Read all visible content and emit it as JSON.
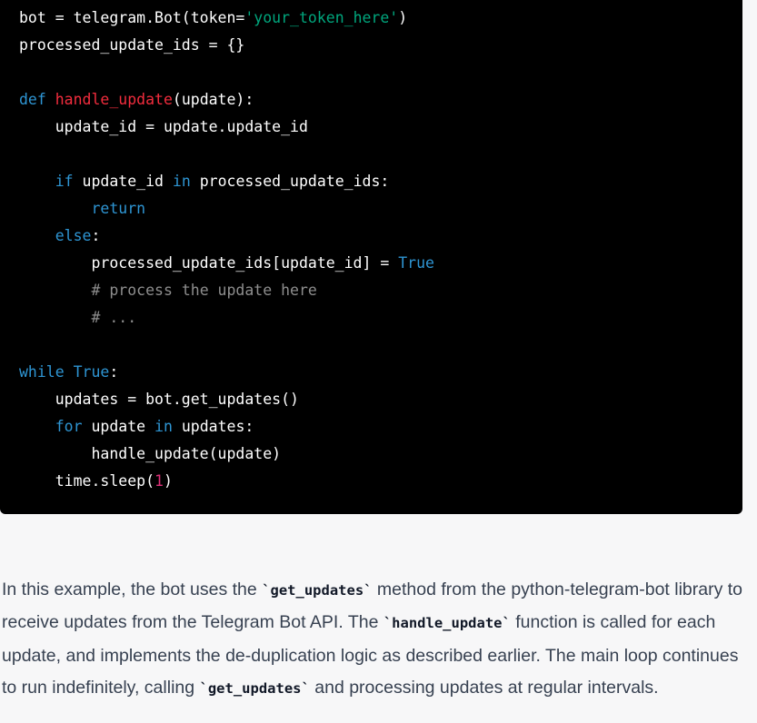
{
  "code": {
    "language": "python",
    "colors": {
      "background": "#000000",
      "plain": "#ffffff",
      "keyword": "#2e95d3",
      "function_name": "#f22c3d",
      "string": "#00a67d",
      "comment": "#8e8e8e",
      "number": "#df3079"
    },
    "lines": [
      [
        [
          "plain",
          "bot = telegram.Bot(token="
        ],
        [
          "str",
          "'your_token_here'"
        ],
        [
          "plain",
          ")"
        ]
      ],
      [
        [
          "plain",
          "processed_update_ids = {}"
        ]
      ],
      [],
      [
        [
          "kw",
          "def"
        ],
        [
          "plain",
          " "
        ],
        [
          "fn",
          "handle_update"
        ],
        [
          "plain",
          "(update):"
        ]
      ],
      [
        [
          "plain",
          "    update_id = update.update_id"
        ]
      ],
      [],
      [
        [
          "plain",
          "    "
        ],
        [
          "kw",
          "if"
        ],
        [
          "plain",
          " update_id "
        ],
        [
          "kw",
          "in"
        ],
        [
          "plain",
          " processed_update_ids:"
        ]
      ],
      [
        [
          "plain",
          "        "
        ],
        [
          "kw",
          "return"
        ]
      ],
      [
        [
          "plain",
          "    "
        ],
        [
          "kw",
          "else"
        ],
        [
          "plain",
          ":"
        ]
      ],
      [
        [
          "plain",
          "        processed_update_ids[update_id] = "
        ],
        [
          "kw",
          "True"
        ]
      ],
      [
        [
          "plain",
          "        "
        ],
        [
          "cm",
          "# process the update here"
        ]
      ],
      [
        [
          "plain",
          "        "
        ],
        [
          "cm",
          "# ..."
        ]
      ],
      [],
      [
        [
          "kw",
          "while"
        ],
        [
          "plain",
          " "
        ],
        [
          "kw",
          "True"
        ],
        [
          "plain",
          ":"
        ]
      ],
      [
        [
          "plain",
          "    updates = bot.get_updates()"
        ]
      ],
      [
        [
          "plain",
          "    "
        ],
        [
          "kw",
          "for"
        ],
        [
          "plain",
          " update "
        ],
        [
          "kw",
          "in"
        ],
        [
          "plain",
          " updates:"
        ]
      ],
      [
        [
          "plain",
          "        handle_update(update)"
        ]
      ],
      [
        [
          "plain",
          "    time.sleep("
        ],
        [
          "num",
          "1"
        ],
        [
          "plain",
          ")"
        ]
      ]
    ]
  },
  "explanation": {
    "segments": [
      {
        "type": "text",
        "value": "In this example, the bot uses the "
      },
      {
        "type": "code",
        "value": "`get_updates`"
      },
      {
        "type": "text",
        "value": " method from the python-telegram-bot library to receive updates from the Telegram Bot API. The "
      },
      {
        "type": "code",
        "value": "`handle_update`"
      },
      {
        "type": "text",
        "value": " function is called for each update, and implements the de-duplication logic as described earlier. The main loop continues to run indefinitely, calling "
      },
      {
        "type": "code",
        "value": "`get_updates`"
      },
      {
        "type": "text",
        "value": " and processing updates at regular intervals."
      }
    ]
  }
}
